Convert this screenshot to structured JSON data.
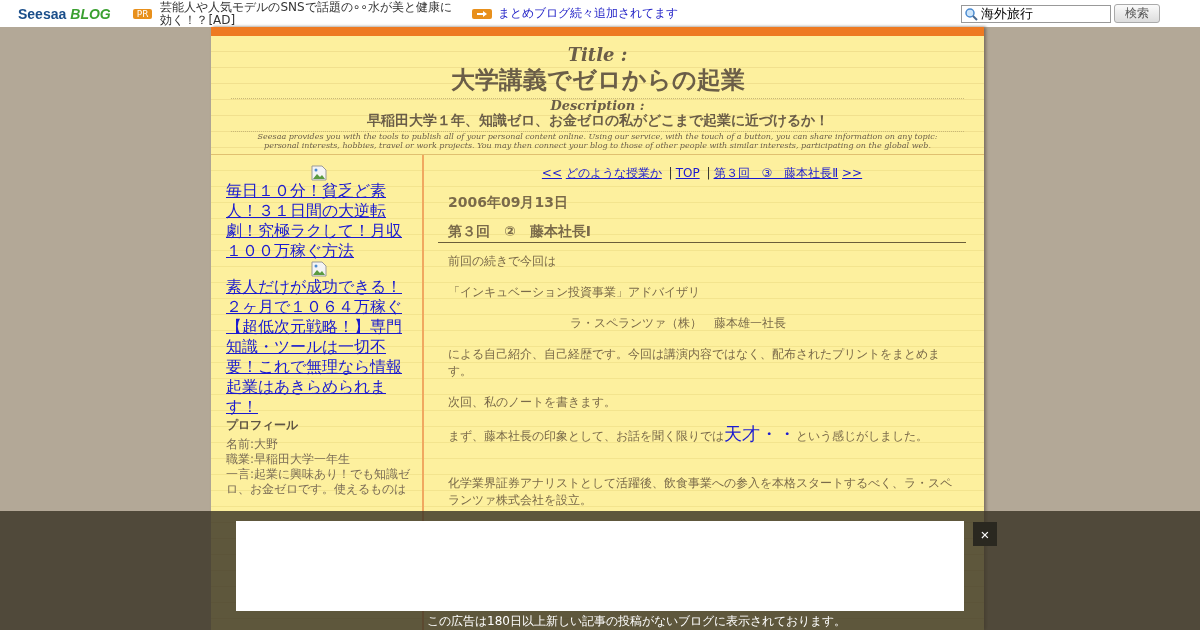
{
  "top_bar": {
    "logo_left": "Seesaa",
    "logo_right": "BLOG",
    "pr_badge": "PR",
    "ad_text": "芸能人や人気モデルのSNSで話題の∘∘水が美と健康に効く！？[AD]",
    "promo_link": "まとめブログ続々追加されてます",
    "search": {
      "value": "海外旅行"
    },
    "search_button": "検索"
  },
  "header": {
    "title_label": "Title :",
    "title": "大学講義でゼロからの起業",
    "description_label": "Description :",
    "description": "早稲田大学１年、知識ゼロ、お金ゼロの私がどこまで起業に近づけるか！",
    "blurb": "Seesaa provides you with the tools to publish all of your personal content online. Using our service, with the touch of a button, you can share information on any topic: personal interests, hobbies, travel or work projects. You may then connect your blog to those of other people with similar interests, participating on the global web."
  },
  "sidebar": {
    "ads": [
      "毎日１０分！貧乏ど素人！３１日間の大逆転劇！究極ラクして！月収１００万稼ぐ方法",
      "素人だけが成功できる！２ヶ月で１０６４万稼ぐ【超低次元戦略！】専門知識・ツールは一切不要！これで無理なら情報起業はあきらめられます！"
    ],
    "profile_heading": "プロフィール",
    "profile_lines": [
      "名前:大野",
      "職業:早稲田大学一年生",
      "一言:起業に興味あり！でも知識ゼロ、お金ゼロです。使えるものは"
    ]
  },
  "article": {
    "nav": [
      {
        "kind": "link",
        "text": "<<"
      },
      {
        "kind": "link",
        "text": "どのような授業か"
      },
      {
        "kind": "sep",
        "text": "|"
      },
      {
        "kind": "link",
        "text": "TOP"
      },
      {
        "kind": "sep",
        "text": "|"
      },
      {
        "kind": "link",
        "text": "第３回　③　藤本社長Ⅱ"
      },
      {
        "kind": "link",
        "text": ">>"
      }
    ],
    "date": "2006年09月13日",
    "title": "第３回　②　藤本社長Ⅰ",
    "paragraphs": [
      {
        "kind": "plain",
        "parts": [
          {
            "kind": "text",
            "text": "前回の続きで今回は"
          }
        ]
      },
      {
        "kind": "plain",
        "parts": [
          {
            "kind": "text",
            "text": "「インキュベーション投資事業」アドバイザリ"
          }
        ]
      },
      {
        "kind": "indented",
        "parts": [
          {
            "kind": "text",
            "text": "ラ・スペランツァ（株）　藤本雄一社長"
          }
        ]
      },
      {
        "kind": "plain",
        "parts": [
          {
            "kind": "text",
            "text": "による自己紹介、自己経歴です。今回は講演内容ではなく、配布されたプリントをまとめます。"
          }
        ]
      },
      {
        "kind": "plain",
        "parts": [
          {
            "kind": "text",
            "text": "次回、私のノートを書きます。"
          }
        ]
      },
      {
        "kind": "plain",
        "parts": [
          {
            "kind": "text",
            "text": "まず、藤本社長の印象として、お話を聞く限りでは"
          },
          {
            "kind": "emphasis",
            "text": "天才・・"
          },
          {
            "kind": "text",
            "text": "という感じがしました。"
          }
        ]
      },
      {
        "kind": "spaced",
        "parts": [
          {
            "kind": "text",
            "text": "化学業界証券アナリストとして活躍後、飲食事業への参入を本格スタートするべく、ラ・スペランツァ株式会社を設立。"
          }
        ]
      }
    ]
  },
  "overlay": {
    "close": "×",
    "notice": "この広告は180日以上新しい記事の投稿がないブログに表示されております。"
  }
}
